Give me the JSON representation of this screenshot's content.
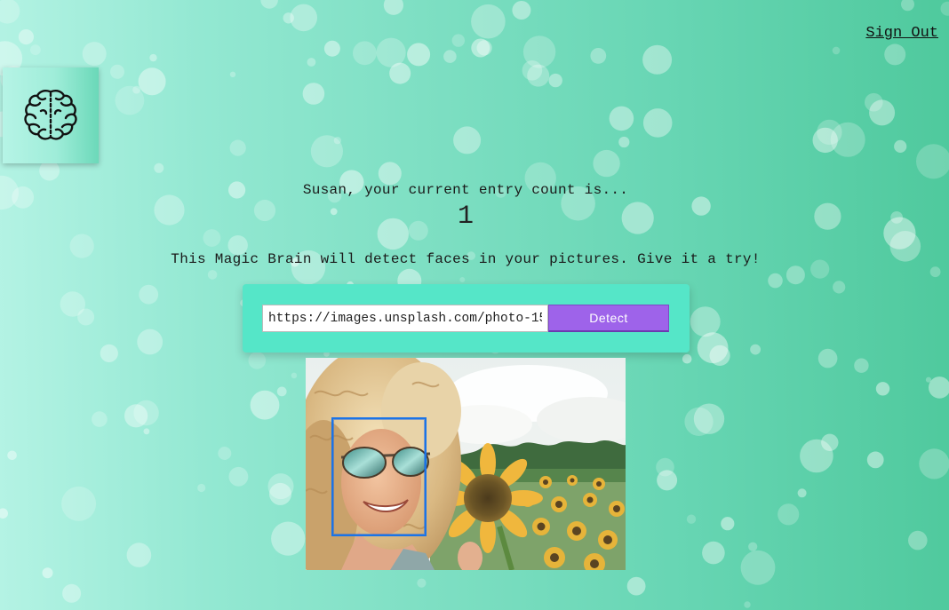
{
  "nav": {
    "signout_label": "Sign Out"
  },
  "logo": {
    "icon": "brain-icon"
  },
  "rank": {
    "message": "Susan, your current entry count is...",
    "count": "1"
  },
  "intro": {
    "text": "This Magic Brain will detect faces in your pictures. Give it a try!"
  },
  "form": {
    "url_value": "https://images.unsplash.com/photo-15",
    "detect_label": "Detect"
  },
  "image": {
    "subject": "smiling woman with curly blonde hair and mirrored sunglasses in a sunflower field",
    "face_box_color": "#1a74e8"
  },
  "theme": {
    "background_start": "#b4f3e4",
    "background_end": "#4fc99d",
    "form_color": "#55e6c8",
    "button_color": "#9e63ea"
  }
}
